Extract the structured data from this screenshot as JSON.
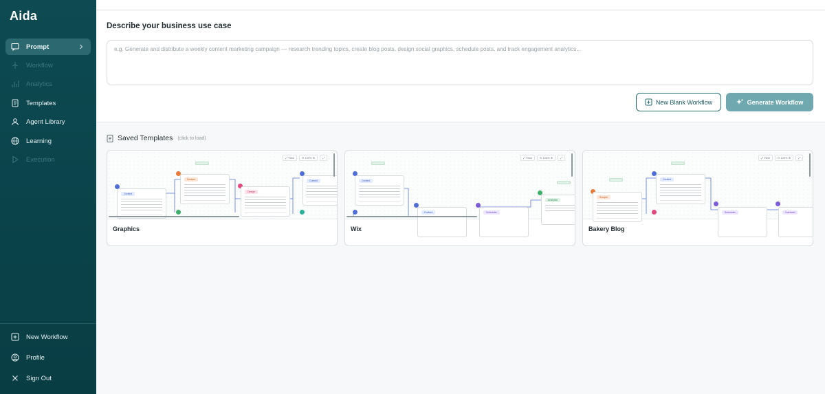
{
  "app": {
    "name": "Aida"
  },
  "sidebar": {
    "items": [
      {
        "label": "Prompt",
        "icon": "message-square-icon",
        "state": "active"
      },
      {
        "label": "Workflow",
        "icon": "workflow-icon",
        "state": "disabled"
      },
      {
        "label": "Analytics",
        "icon": "bar-chart-icon",
        "state": "disabled"
      },
      {
        "label": "Templates",
        "icon": "document-icon",
        "state": "enabled"
      },
      {
        "label": "Agent Library",
        "icon": "agent-icon",
        "state": "enabled"
      },
      {
        "label": "Learning",
        "icon": "globe-icon",
        "state": "enabled"
      },
      {
        "label": "Execution",
        "icon": "play-icon",
        "state": "disabled"
      }
    ],
    "bottom_items": [
      {
        "label": "New Workflow",
        "icon": "plus-square-icon"
      },
      {
        "label": "Profile",
        "icon": "user-circle-icon"
      },
      {
        "label": "Sign Out",
        "icon": "close-icon"
      }
    ]
  },
  "prompt": {
    "heading": "Describe your business use case",
    "placeholder": "e.g. Generate and distribute a weekly content marketing campaign — research trending topics, create blog posts, design social graphics, schedule posts, and track engagement analytics...",
    "new_blank_label": "New Blank Workflow",
    "generate_label": "Generate Workflow"
  },
  "saved_templates": {
    "title": "Saved Templates",
    "hint": "(click to load)",
    "cards": [
      {
        "name": "Graphics"
      },
      {
        "name": "Wix"
      },
      {
        "name": "Bakery Blog"
      }
    ]
  },
  "colors": {
    "sidebar_bg": "#0d4a52",
    "active_item_bg": "#2c6870",
    "accent": "#236b73",
    "generate_button_bg": "#6fa8ae"
  }
}
